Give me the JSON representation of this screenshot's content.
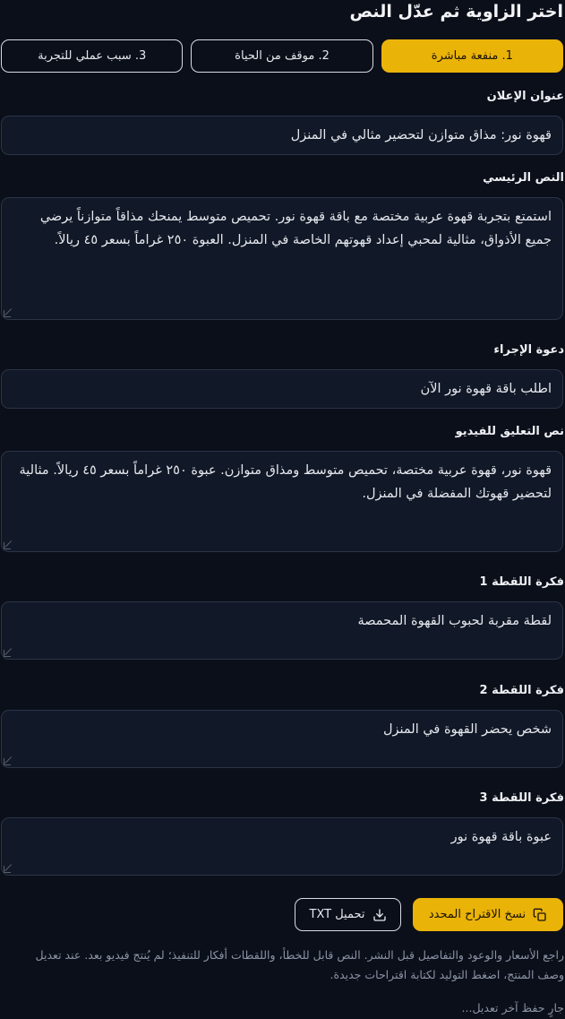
{
  "page": {
    "title": "اختر الزاوية ثم عدّل النص"
  },
  "tabs": [
    {
      "label": "1. منفعة مباشرة",
      "active": true
    },
    {
      "label": "2. موقف من الحياة",
      "active": false
    },
    {
      "label": "3. سبب عملي للتجربة",
      "active": false
    }
  ],
  "fields": {
    "headline": {
      "label": "عنوان الإعلان",
      "value": "قهوة نور: مذاق متوازن لتحضير مثالي في المنزل"
    },
    "body": {
      "label": "النص الرئيسي",
      "value": "استمتع بتجربة قهوة عربية مختصة مع باقة قهوة نور. تحميص متوسط يمنحك مذاقاً متوازناً يرضي جميع الأذواق، مثالية لمحبي إعداد قهوتهم الخاصة في المنزل. العبوة ٢٥٠ غراماً بسعر ٤٥ ريالاً."
    },
    "cta": {
      "label": "دعوة الإجراء",
      "value": "اطلب باقة قهوة نور الآن"
    },
    "voiceover": {
      "label": "نص التعليق للفيديو",
      "value": "قهوة نور، قهوة عربية مختصة، تحميص متوسط ومذاق متوازن. عبوة ٢٥٠ غراماً بسعر ٤٥ ريالاً. مثالية لتحضير قهوتك المفضلة في المنزل."
    },
    "shot1": {
      "label": "فكرة اللقطة 1",
      "value": "لقطة مقربة لحبوب القهوة المحمصة"
    },
    "shot2": {
      "label": "فكرة اللقطة 2",
      "value": "شخص يحضر القهوة في المنزل"
    },
    "shot3": {
      "label": "فكرة اللقطة 3",
      "value": "عبوة باقة قهوة نور"
    }
  },
  "actions": {
    "copy_label": "نسخ الاقتراح المحدد",
    "copy_icon": "copy-icon",
    "download_label": "تحميل TXT",
    "download_icon": "download-icon"
  },
  "footer": {
    "note": "راجع الأسعار والوعود والتفاصيل قبل النشر. النص قابل للخطأ، واللقطات أفكار للتنفيذ؛ لم يُنتج فيديو بعد. عند تعديل وصف المنتج، اضغط التوليد لكتابة اقتراحات جديدة.",
    "autosave": "جارٍ حفظ آخر تعديل..."
  },
  "colors": {
    "background": "#0b0f19",
    "field_bg": "#111827",
    "field_border": "#2b3448",
    "accent": "#eab308",
    "muted_text": "#8b93a6"
  }
}
